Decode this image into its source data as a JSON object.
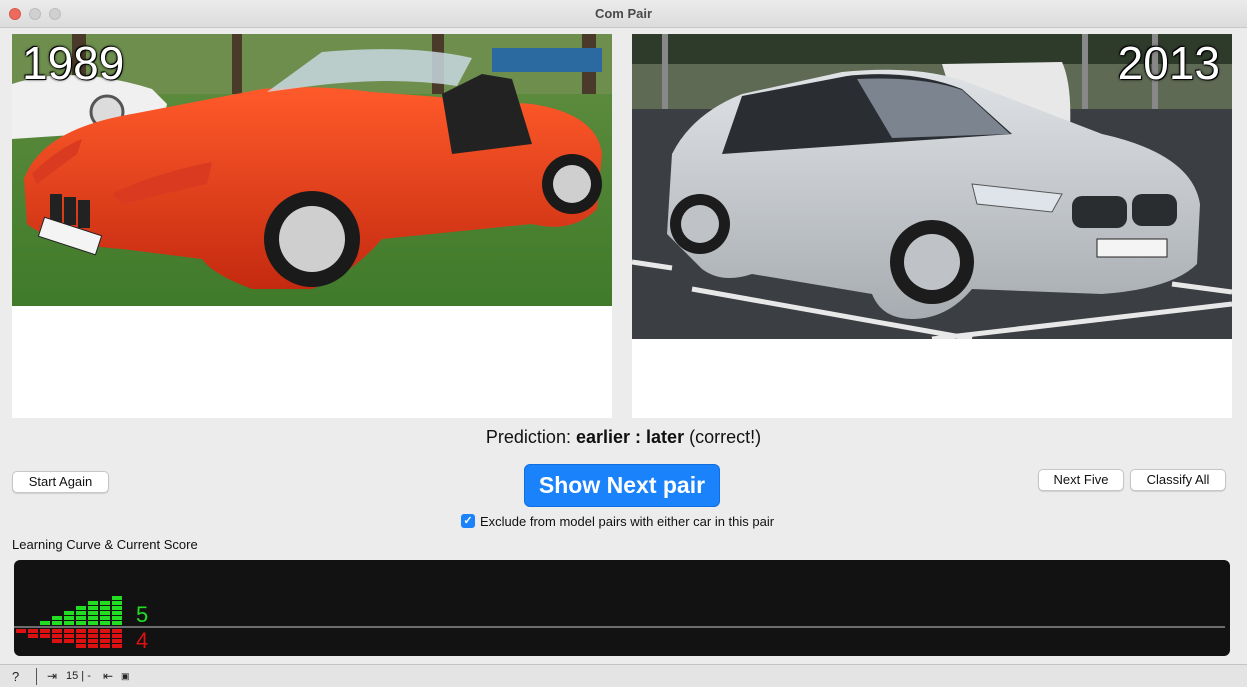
{
  "window": {
    "title": "Com Pair"
  },
  "left_image": {
    "year": "1989",
    "description_icon": "photo-red-convertible"
  },
  "right_image": {
    "year": "2013",
    "description_icon": "photo-silver-hatchback"
  },
  "prediction": {
    "prefix": "Prediction:",
    "left_choice": "earlier",
    "separator": ":",
    "right_choice": "later",
    "result": "(correct!)"
  },
  "buttons": {
    "start_again": "Start Again",
    "show_next_pair": "Show Next pair",
    "next_five": "Next Five",
    "classify_all": "Classify All"
  },
  "exclude": {
    "checked": true,
    "label": "Exclude from model pairs with either car in this pair"
  },
  "learning_curve": {
    "label": "Learning Curve & Current Score",
    "correct_score": "5",
    "wrong_score": "4",
    "colors": {
      "correct": "#22dd22",
      "wrong": "#dd1111",
      "background": "#121212",
      "baseline": "#c8c8c8"
    },
    "correct_levels": [
      0,
      0,
      1,
      2,
      3,
      4,
      5,
      5,
      6
    ],
    "wrong_levels": [
      1,
      2,
      2,
      3,
      3,
      4,
      4,
      4,
      4
    ]
  },
  "statusbar": {
    "help_icon": "question-icon",
    "input_icon": "sign-in-icon",
    "input_value": "15 | -",
    "output_icon": "sign-out-icon",
    "output_value": "▣"
  }
}
